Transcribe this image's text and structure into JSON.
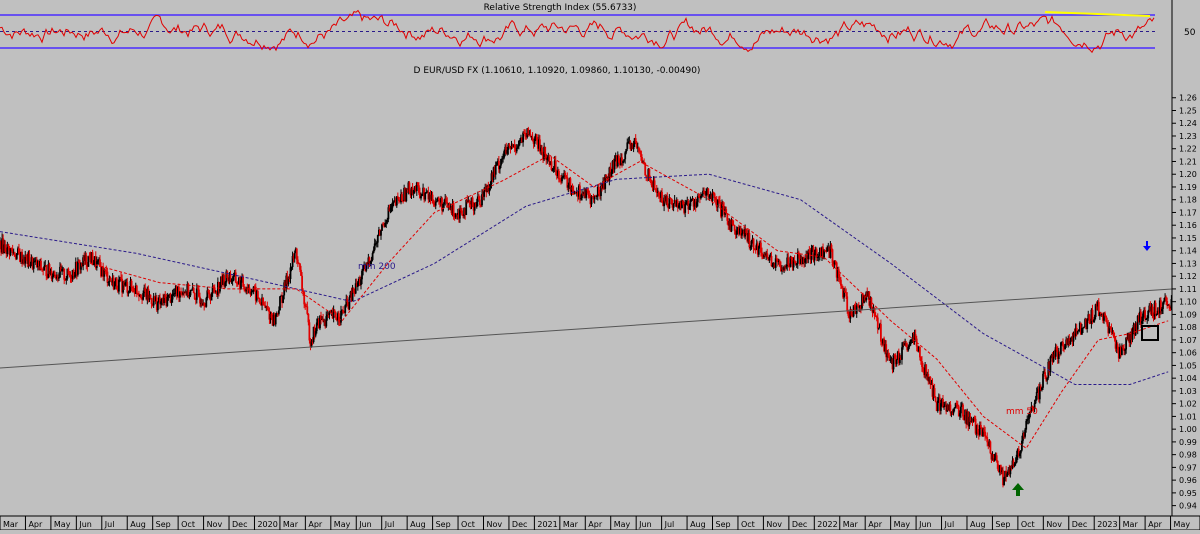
{
  "rsi_panel": {
    "title": "Relative Strength Index (55.6733)",
    "tick_label": "50",
    "range": [
      0,
      100
    ],
    "upper_band": 70,
    "lower_band": 30,
    "mid_level": 50,
    "line_color": "#e00000",
    "band_color": "#4a2cff",
    "highlight_color": "#ffff00"
  },
  "price_panel": {
    "title": "D EUR/USD FX (1.10610, 1.10920, 1.09860, 1.10130, -0.00490)",
    "annotations": {
      "mm200": "mm 200",
      "mm50": "mm 50"
    },
    "colors": {
      "up": "#000000",
      "down": "#e00000",
      "mm50": "#e00000",
      "mm200": "#2a1a8a",
      "trendline": "#555555",
      "up_arrow": "#006400",
      "down_arrow": "#0000ff"
    }
  },
  "chart_data": {
    "type": "candlestick",
    "title": "D EUR/USD FX (1.10610, 1.10920, 1.09860, 1.10130, -0.00490)",
    "ylim": [
      0.935,
      1.27
    ],
    "y_ticks": [
      0.94,
      0.95,
      0.96,
      0.97,
      0.98,
      0.99,
      1.0,
      1.01,
      1.02,
      1.03,
      1.04,
      1.05,
      1.06,
      1.07,
      1.08,
      1.09,
      1.1,
      1.11,
      1.12,
      1.13,
      1.14,
      1.15,
      1.16,
      1.17,
      1.18,
      1.19,
      1.2,
      1.21,
      1.22,
      1.23,
      1.24,
      1.25,
      1.26
    ],
    "x_ticks": [
      "Mar",
      "Apr",
      "May",
      "Jun",
      "Jul",
      "Aug",
      "Sep",
      "Oct",
      "Nov",
      "Dec",
      "2020",
      "Mar",
      "Apr",
      "May",
      "Jun",
      "Jul",
      "Aug",
      "Sep",
      "Oct",
      "Nov",
      "Dec",
      "2021",
      "Mar",
      "Apr",
      "May",
      "Jun",
      "Jul",
      "Aug",
      "Sep",
      "Oct",
      "Nov",
      "Dec",
      "2022",
      "Mar",
      "Apr",
      "May",
      "Jun",
      "Jul",
      "Aug",
      "Sep",
      "Oct",
      "Nov",
      "Dec",
      "2023",
      "Mar",
      "Apr",
      "May"
    ],
    "x_range": [
      "2019-02-01",
      "2023-05-10"
    ],
    "close_series": [
      {
        "date": "2019-02-01",
        "close": 1.145
      },
      {
        "date": "2019-03-01",
        "close": 1.135
      },
      {
        "date": "2019-04-01",
        "close": 1.125
      },
      {
        "date": "2019-05-01",
        "close": 1.12
      },
      {
        "date": "2019-06-01",
        "close": 1.135
      },
      {
        "date": "2019-07-01",
        "close": 1.115
      },
      {
        "date": "2019-08-01",
        "close": 1.11
      },
      {
        "date": "2019-09-01",
        "close": 1.098
      },
      {
        "date": "2019-10-01",
        "close": 1.11
      },
      {
        "date": "2019-11-01",
        "close": 1.102
      },
      {
        "date": "2019-12-01",
        "close": 1.12
      },
      {
        "date": "2020-01-01",
        "close": 1.11
      },
      {
        "date": "2020-02-01",
        "close": 1.085
      },
      {
        "date": "2020-03-01",
        "close": 1.14
      },
      {
        "date": "2020-03-20",
        "close": 1.07
      },
      {
        "date": "2020-04-01",
        "close": 1.085
      },
      {
        "date": "2020-05-01",
        "close": 1.09
      },
      {
        "date": "2020-06-01",
        "close": 1.125
      },
      {
        "date": "2020-07-01",
        "close": 1.17
      },
      {
        "date": "2020-08-01",
        "close": 1.19
      },
      {
        "date": "2020-09-01",
        "close": 1.18
      },
      {
        "date": "2020-10-01",
        "close": 1.17
      },
      {
        "date": "2020-11-01",
        "close": 1.18
      },
      {
        "date": "2020-12-01",
        "close": 1.215
      },
      {
        "date": "2021-01-06",
        "close": 1.232
      },
      {
        "date": "2021-02-01",
        "close": 1.21
      },
      {
        "date": "2021-03-01",
        "close": 1.19
      },
      {
        "date": "2021-04-01",
        "close": 1.18
      },
      {
        "date": "2021-05-01",
        "close": 1.21
      },
      {
        "date": "2021-05-25",
        "close": 1.225
      },
      {
        "date": "2021-06-15",
        "close": 1.195
      },
      {
        "date": "2021-07-01",
        "close": 1.18
      },
      {
        "date": "2021-08-01",
        "close": 1.175
      },
      {
        "date": "2021-09-01",
        "close": 1.185
      },
      {
        "date": "2021-10-01",
        "close": 1.16
      },
      {
        "date": "2021-11-01",
        "close": 1.145
      },
      {
        "date": "2021-12-01",
        "close": 1.128
      },
      {
        "date": "2022-01-01",
        "close": 1.135
      },
      {
        "date": "2022-02-10",
        "close": 1.14
      },
      {
        "date": "2022-03-07",
        "close": 1.09
      },
      {
        "date": "2022-04-01",
        "close": 1.105
      },
      {
        "date": "2022-05-01",
        "close": 1.05
      },
      {
        "date": "2022-06-01",
        "close": 1.07
      },
      {
        "date": "2022-07-01",
        "close": 1.02
      },
      {
        "date": "2022-08-01",
        "close": 1.015
      },
      {
        "date": "2022-09-01",
        "close": 0.995
      },
      {
        "date": "2022-09-28",
        "close": 0.96
      },
      {
        "date": "2022-10-15",
        "close": 0.975
      },
      {
        "date": "2022-11-01",
        "close": 1.01
      },
      {
        "date": "2022-12-01",
        "close": 1.055
      },
      {
        "date": "2023-01-01",
        "close": 1.075
      },
      {
        "date": "2023-02-01",
        "close": 1.095
      },
      {
        "date": "2023-03-01",
        "close": 1.06
      },
      {
        "date": "2023-04-01",
        "close": 1.09
      },
      {
        "date": "2023-05-05",
        "close": 1.1
      }
    ],
    "mm50": [
      {
        "date": "2019-06-01",
        "value": 1.13
      },
      {
        "date": "2019-09-01",
        "value": 1.115
      },
      {
        "date": "2019-12-01",
        "value": 1.11
      },
      {
        "date": "2020-03-01",
        "value": 1.11
      },
      {
        "date": "2020-05-01",
        "value": 1.085
      },
      {
        "date": "2020-07-01",
        "value": 1.13
      },
      {
        "date": "2020-09-01",
        "value": 1.17
      },
      {
        "date": "2020-12-01",
        "value": 1.195
      },
      {
        "date": "2021-02-01",
        "value": 1.215
      },
      {
        "date": "2021-04-01",
        "value": 1.19
      },
      {
        "date": "2021-06-01",
        "value": 1.21
      },
      {
        "date": "2021-09-01",
        "value": 1.18
      },
      {
        "date": "2021-12-01",
        "value": 1.14
      },
      {
        "date": "2022-02-01",
        "value": 1.135
      },
      {
        "date": "2022-05-01",
        "value": 1.085
      },
      {
        "date": "2022-07-01",
        "value": 1.055
      },
      {
        "date": "2022-09-01",
        "value": 1.01
      },
      {
        "date": "2022-10-28",
        "value": 0.985
      },
      {
        "date": "2022-12-15",
        "value": 1.03
      },
      {
        "date": "2023-02-01",
        "value": 1.07
      },
      {
        "date": "2023-03-15",
        "value": 1.075
      },
      {
        "date": "2023-05-05",
        "value": 1.085
      }
    ],
    "mm200": [
      {
        "date": "2019-02-01",
        "value": 1.155
      },
      {
        "date": "2019-08-01",
        "value": 1.138
      },
      {
        "date": "2020-01-01",
        "value": 1.118
      },
      {
        "date": "2020-05-15",
        "value": 1.1
      },
      {
        "date": "2020-09-01",
        "value": 1.13
      },
      {
        "date": "2021-01-01",
        "value": 1.175
      },
      {
        "date": "2021-05-01",
        "value": 1.196
      },
      {
        "date": "2021-09-01",
        "value": 1.2
      },
      {
        "date": "2022-01-01",
        "value": 1.18
      },
      {
        "date": "2022-05-01",
        "value": 1.13
      },
      {
        "date": "2022-09-01",
        "value": 1.075
      },
      {
        "date": "2023-01-01",
        "value": 1.035
      },
      {
        "date": "2023-03-15",
        "value": 1.035
      },
      {
        "date": "2023-05-05",
        "value": 1.045
      }
    ],
    "trendline": {
      "start": {
        "date": "2019-02-01",
        "value": 1.048
      },
      "end": {
        "date": "2023-05-10",
        "value": 1.11
      }
    },
    "grid": false,
    "legend": "none"
  }
}
